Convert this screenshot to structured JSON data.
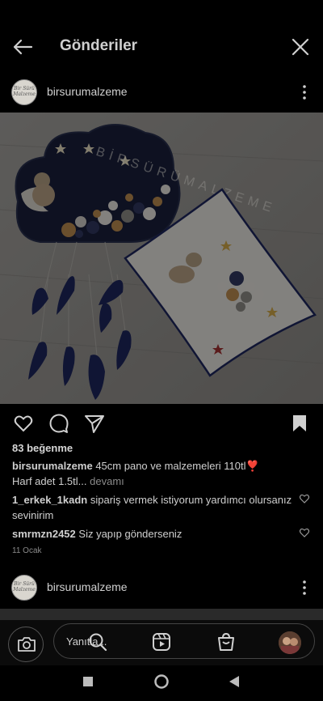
{
  "header": {
    "title": "Gönderiler"
  },
  "post": {
    "username": "birsurumalzeme",
    "avatar_text": "Bir Sürü Malzeme",
    "watermark": "BİRSÜRÜMALZEME",
    "likes": "83 beğenme",
    "caption_user": "birsurumalzeme",
    "caption_text": "45cm pano ve malzemeleri 110tl❣️",
    "caption_line2": "Harf adet 1.5tl...",
    "caption_more": "devamı",
    "comments": [
      {
        "user": "1_erkek_1kadn",
        "text": "sipariş vermek istiyorum yardımcı olursanız sevinirim"
      },
      {
        "user": "smrmzn2452",
        "text": "Siz yapıp gönderseniz"
      }
    ],
    "date": "11 Ocak"
  },
  "next_post": {
    "username": "birsurumalzeme"
  },
  "bottom_nav": {
    "reply_placeholder": "Yanıtla..."
  },
  "colors": {
    "background": "#000000",
    "navy": "#1c2447",
    "text": "#d0d0d0"
  }
}
